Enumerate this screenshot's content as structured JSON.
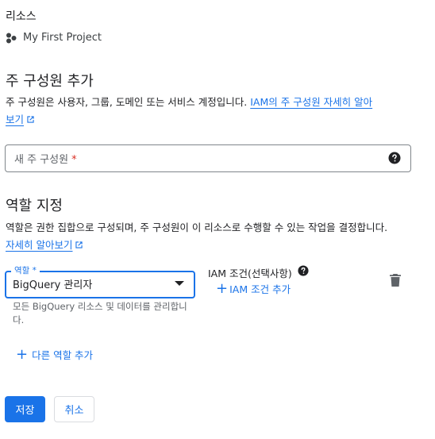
{
  "resource": {
    "heading": "리소스",
    "project_name": "My First Project",
    "project_icon": "project-hub-icon"
  },
  "principals": {
    "title": "주 구성원 추가",
    "description": "주 구성원은 사용자, 그룹, 도메인 또는 서비스 계정입니다. ",
    "link_part1": "IAM의 주 구성원 자세히 알아",
    "link_part2": "보기",
    "field_placeholder": "새 주 구성원",
    "required_mark": "*"
  },
  "roles": {
    "title": "역할 지정",
    "description": "역할은 권한 집합으로 구성되며, 주 구성원이 이 리소스로 수행할 수 있는 작업을 결정합니다.",
    "link_text": "자세히 알아보기",
    "select_label": "역할 *",
    "selected_role": "BigQuery 관리자",
    "role_hint": "모든 BigQuery 리소스 및 데이터를 관리합니다.",
    "iam_condition_label": "IAM 조건(선택사항)",
    "iam_add_label": "IAM 조건 추가",
    "add_another_role": "다른 역할 추가"
  },
  "actions": {
    "save": "저장",
    "cancel": "취소"
  },
  "colors": {
    "accent": "#1a73e8",
    "required": "#d93025",
    "text": "#202124",
    "muted": "#5f6368"
  }
}
